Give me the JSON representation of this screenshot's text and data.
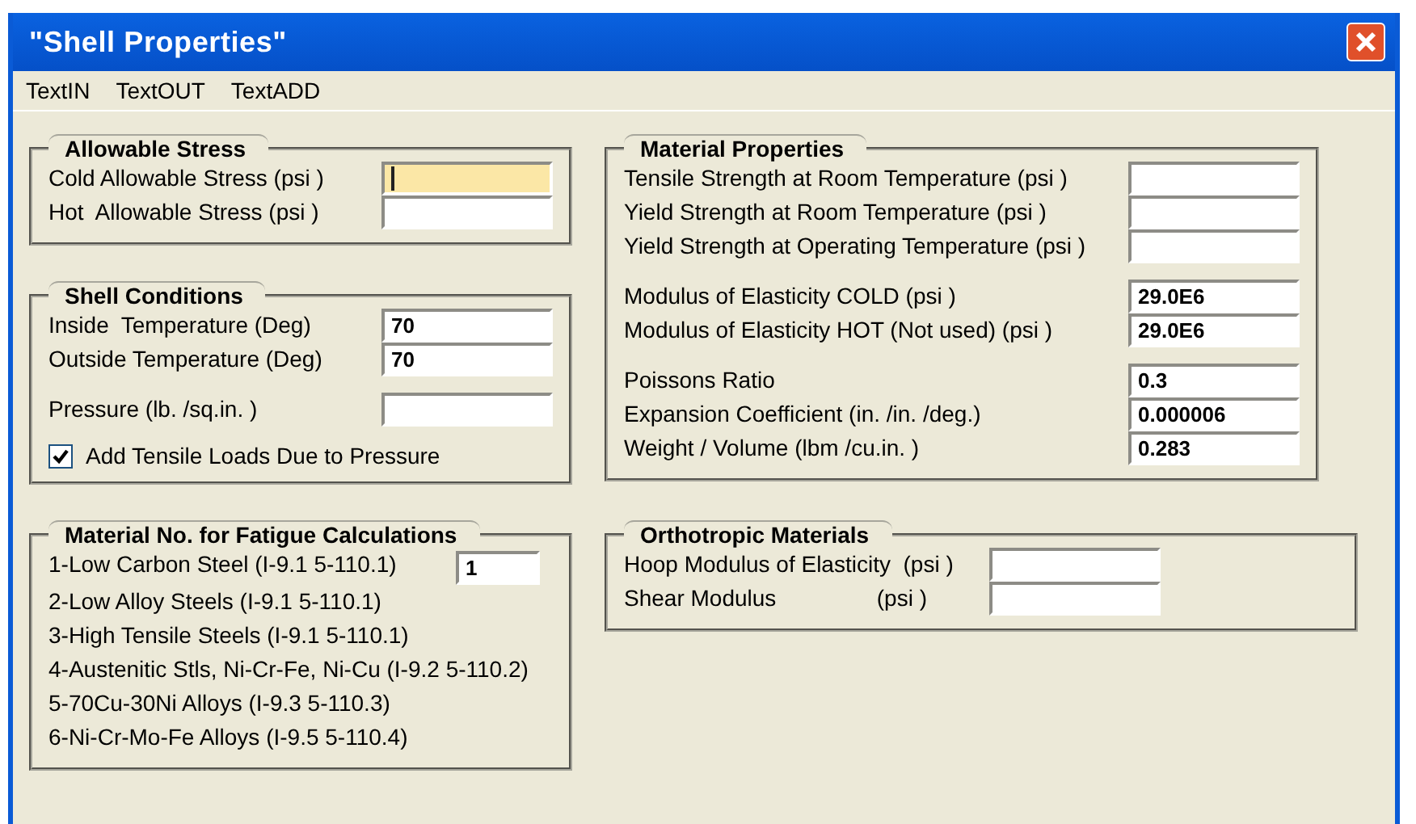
{
  "window": {
    "title": "\"Shell Properties\""
  },
  "menu": [
    "TextIN",
    "TextOUT",
    "TextADD"
  ],
  "allowable_stress": {
    "title": "Allowable Stress",
    "blocks": [
      [
        {
          "label": "Cold Allowable Stress (psi )",
          "focused": true
        },
        {
          "label": "Hot  Allowable Stress (psi )",
          "focused": false
        }
      ]
    ]
  },
  "shell_conditions": {
    "title": "Shell Conditions",
    "blocks": [
      [
        {
          "label": "Inside  Temperature (Deg)",
          "value": "70",
          "focused": false
        },
        {
          "label": "Outside Temperature (Deg)",
          "value": "70",
          "focused": false
        }
      ],
      [
        {
          "label": "Pressure (lb. /sq.in. )",
          "focused": false
        }
      ]
    ],
    "checkbox": {
      "label": "Add Tensile Loads Due to Pressure",
      "checked": true
    }
  },
  "fatigue_material": {
    "title": "Material No. for Fatigue Calculations",
    "options": [
      "1-Low Carbon Steel (I-9.1 5-110.1)",
      "2-Low Alloy Steels (I-9.1 5-110.1)",
      "3-High Tensile Steels (I-9.1 5-110.1)",
      "4-Austenitic Stls, Ni-Cr-Fe, Ni-Cu (I-9.2 5-110.2)",
      "5-70Cu-30Ni Alloys (I-9.3 5-110.3)",
      "6-Ni-Cr-Mo-Fe Alloys (I-9.5 5-110.4)"
    ],
    "field": {
      "value": "1",
      "focused": false
    }
  },
  "material_properties": {
    "title": "Material Properties",
    "blocks": [
      [
        {
          "label": "Tensile Strength at Room Temperature (psi )",
          "focused": false
        },
        {
          "label": "Yield Strength at Room Temperature (psi )",
          "focused": false
        },
        {
          "label": "Yield Strength at Operating Temperature (psi )",
          "focused": false
        }
      ],
      [
        {
          "label": "Modulus of Elasticity COLD (psi )",
          "value": "29.0E6",
          "focused": false
        },
        {
          "label": "Modulus of Elasticity HOT (Not used) (psi )",
          "value": "29.0E6",
          "focused": false
        }
      ],
      [
        {
          "label": "Poissons Ratio",
          "value": "0.3",
          "focused": false
        },
        {
          "label": "Expansion Coefficient (in. /in. /deg.)",
          "value": "0.000006",
          "focused": false
        },
        {
          "label": "Weight / Volume (lbm /cu.in. )",
          "value": "0.283",
          "focused": false
        }
      ]
    ]
  },
  "orthotropic": {
    "title": "Orthotropic Materials",
    "blocks": [
      [
        {
          "label": "Hoop Modulus of Elasticity  (psi )",
          "focused": false
        },
        {
          "label": "Shear Modulus                (psi )",
          "focused": false
        }
      ]
    ]
  }
}
